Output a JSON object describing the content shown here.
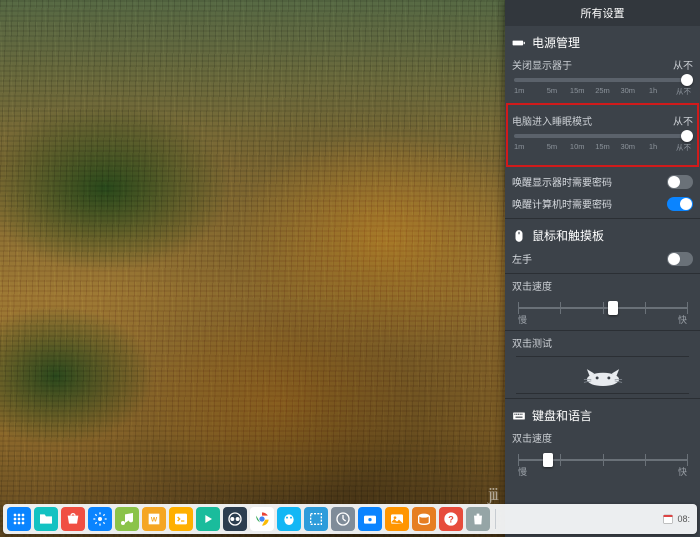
{
  "panel": {
    "title": "所有设置",
    "sections": {
      "power": {
        "title": "电源管理",
        "displayOff": {
          "label": "关闭显示器于",
          "value": "从不",
          "thumbPct": 98,
          "ticks": [
            "1m",
            "5m",
            "15m",
            "25m",
            "30m",
            "1h",
            "从不"
          ]
        },
        "sleep": {
          "label": "电脑进入睡眠模式",
          "value": "从不",
          "thumbPct": 98,
          "ticks": [
            "1m",
            "5m",
            "10m",
            "15m",
            "30m",
            "1h",
            "从不"
          ]
        },
        "wakeDisplayPwd": {
          "label": "唤醒显示器时需要密码",
          "on": false
        },
        "wakeComputerPwd": {
          "label": "唤醒计算机时需要密码",
          "on": true
        }
      },
      "mouse": {
        "title": "鼠标和触摸板",
        "leftHand": {
          "label": "左手",
          "on": false
        },
        "dblSpeed": {
          "label": "双击速度",
          "thumbPct": 56,
          "slow": "慢",
          "fast": "快"
        },
        "dblTest": {
          "label": "双击测试"
        }
      },
      "keyboard": {
        "title": "键盘和语言",
        "repeat": {
          "label": "双击速度",
          "thumbPct": 18,
          "slow": "慢",
          "fast": "快"
        }
      }
    }
  },
  "dock": {
    "items": [
      {
        "name": "launcher",
        "bg": "#0a84ff"
      },
      {
        "name": "files",
        "bg": "#13c2c2"
      },
      {
        "name": "store",
        "bg": "#f04f43"
      },
      {
        "name": "control-center",
        "bg": "#0a84ff"
      },
      {
        "name": "music",
        "bg": "#8bc34a"
      },
      {
        "name": "wps",
        "bg": "#f5a623"
      },
      {
        "name": "terminal",
        "bg": "#ffb000"
      },
      {
        "name": "movie",
        "bg": "#1abc9c"
      },
      {
        "name": "crossover",
        "bg": "#2c3e50"
      },
      {
        "name": "chrome",
        "bg": "#ffffff"
      },
      {
        "name": "qq",
        "bg": "#12b7f5"
      },
      {
        "name": "screenshot",
        "bg": "#2d9cdb"
      },
      {
        "name": "system-monitor",
        "bg": "#7f8c99"
      },
      {
        "name": "camera",
        "bg": "#0a84ff"
      },
      {
        "name": "image-viewer",
        "bg": "#ff9500"
      },
      {
        "name": "disks",
        "bg": "#e67e22"
      },
      {
        "name": "help",
        "bg": "#e74c3c"
      },
      {
        "name": "trash",
        "bg": "#95a5a6"
      }
    ],
    "clock": "08:"
  },
  "watermark": "jii"
}
